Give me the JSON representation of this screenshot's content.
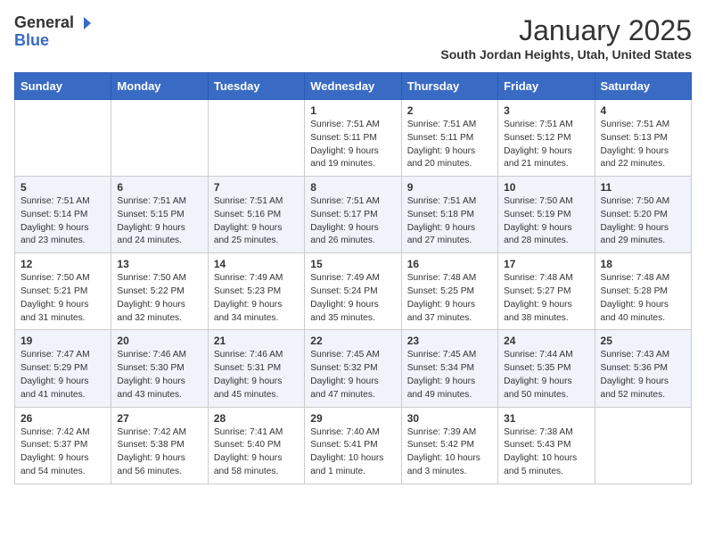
{
  "logo": {
    "line1": "General",
    "line2": "Blue",
    "icon": "▶"
  },
  "header": {
    "title": "January 2025",
    "subtitle": "South Jordan Heights, Utah, United States"
  },
  "weekdays": [
    "Sunday",
    "Monday",
    "Tuesday",
    "Wednesday",
    "Thursday",
    "Friday",
    "Saturday"
  ],
  "weeks": [
    [
      {
        "day": "",
        "info": ""
      },
      {
        "day": "",
        "info": ""
      },
      {
        "day": "",
        "info": ""
      },
      {
        "day": "1",
        "info": "Sunrise: 7:51 AM\nSunset: 5:11 PM\nDaylight: 9 hours\nand 19 minutes."
      },
      {
        "day": "2",
        "info": "Sunrise: 7:51 AM\nSunset: 5:11 PM\nDaylight: 9 hours\nand 20 minutes."
      },
      {
        "day": "3",
        "info": "Sunrise: 7:51 AM\nSunset: 5:12 PM\nDaylight: 9 hours\nand 21 minutes."
      },
      {
        "day": "4",
        "info": "Sunrise: 7:51 AM\nSunset: 5:13 PM\nDaylight: 9 hours\nand 22 minutes."
      }
    ],
    [
      {
        "day": "5",
        "info": "Sunrise: 7:51 AM\nSunset: 5:14 PM\nDaylight: 9 hours\nand 23 minutes."
      },
      {
        "day": "6",
        "info": "Sunrise: 7:51 AM\nSunset: 5:15 PM\nDaylight: 9 hours\nand 24 minutes."
      },
      {
        "day": "7",
        "info": "Sunrise: 7:51 AM\nSunset: 5:16 PM\nDaylight: 9 hours\nand 25 minutes."
      },
      {
        "day": "8",
        "info": "Sunrise: 7:51 AM\nSunset: 5:17 PM\nDaylight: 9 hours\nand 26 minutes."
      },
      {
        "day": "9",
        "info": "Sunrise: 7:51 AM\nSunset: 5:18 PM\nDaylight: 9 hours\nand 27 minutes."
      },
      {
        "day": "10",
        "info": "Sunrise: 7:50 AM\nSunset: 5:19 PM\nDaylight: 9 hours\nand 28 minutes."
      },
      {
        "day": "11",
        "info": "Sunrise: 7:50 AM\nSunset: 5:20 PM\nDaylight: 9 hours\nand 29 minutes."
      }
    ],
    [
      {
        "day": "12",
        "info": "Sunrise: 7:50 AM\nSunset: 5:21 PM\nDaylight: 9 hours\nand 31 minutes."
      },
      {
        "day": "13",
        "info": "Sunrise: 7:50 AM\nSunset: 5:22 PM\nDaylight: 9 hours\nand 32 minutes."
      },
      {
        "day": "14",
        "info": "Sunrise: 7:49 AM\nSunset: 5:23 PM\nDaylight: 9 hours\nand 34 minutes."
      },
      {
        "day": "15",
        "info": "Sunrise: 7:49 AM\nSunset: 5:24 PM\nDaylight: 9 hours\nand 35 minutes."
      },
      {
        "day": "16",
        "info": "Sunrise: 7:48 AM\nSunset: 5:25 PM\nDaylight: 9 hours\nand 37 minutes."
      },
      {
        "day": "17",
        "info": "Sunrise: 7:48 AM\nSunset: 5:27 PM\nDaylight: 9 hours\nand 38 minutes."
      },
      {
        "day": "18",
        "info": "Sunrise: 7:48 AM\nSunset: 5:28 PM\nDaylight: 9 hours\nand 40 minutes."
      }
    ],
    [
      {
        "day": "19",
        "info": "Sunrise: 7:47 AM\nSunset: 5:29 PM\nDaylight: 9 hours\nand 41 minutes."
      },
      {
        "day": "20",
        "info": "Sunrise: 7:46 AM\nSunset: 5:30 PM\nDaylight: 9 hours\nand 43 minutes."
      },
      {
        "day": "21",
        "info": "Sunrise: 7:46 AM\nSunset: 5:31 PM\nDaylight: 9 hours\nand 45 minutes."
      },
      {
        "day": "22",
        "info": "Sunrise: 7:45 AM\nSunset: 5:32 PM\nDaylight: 9 hours\nand 47 minutes."
      },
      {
        "day": "23",
        "info": "Sunrise: 7:45 AM\nSunset: 5:34 PM\nDaylight: 9 hours\nand 49 minutes."
      },
      {
        "day": "24",
        "info": "Sunrise: 7:44 AM\nSunset: 5:35 PM\nDaylight: 9 hours\nand 50 minutes."
      },
      {
        "day": "25",
        "info": "Sunrise: 7:43 AM\nSunset: 5:36 PM\nDaylight: 9 hours\nand 52 minutes."
      }
    ],
    [
      {
        "day": "26",
        "info": "Sunrise: 7:42 AM\nSunset: 5:37 PM\nDaylight: 9 hours\nand 54 minutes."
      },
      {
        "day": "27",
        "info": "Sunrise: 7:42 AM\nSunset: 5:38 PM\nDaylight: 9 hours\nand 56 minutes."
      },
      {
        "day": "28",
        "info": "Sunrise: 7:41 AM\nSunset: 5:40 PM\nDaylight: 9 hours\nand 58 minutes."
      },
      {
        "day": "29",
        "info": "Sunrise: 7:40 AM\nSunset: 5:41 PM\nDaylight: 10 hours\nand 1 minute."
      },
      {
        "day": "30",
        "info": "Sunrise: 7:39 AM\nSunset: 5:42 PM\nDaylight: 10 hours\nand 3 minutes."
      },
      {
        "day": "31",
        "info": "Sunrise: 7:38 AM\nSunset: 5:43 PM\nDaylight: 10 hours\nand 5 minutes."
      },
      {
        "day": "",
        "info": ""
      }
    ]
  ]
}
